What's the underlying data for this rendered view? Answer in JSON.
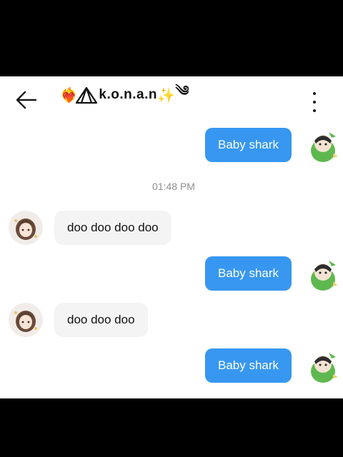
{
  "header": {
    "title": "k.o.n.a.n",
    "title_prefix_icon": "heart-on-fire-emoji",
    "title_suffix_icons": [
      "sparkles-emoji",
      "wind-swirl-emoji"
    ],
    "back_icon": "back-arrow-icon",
    "menu_icon": "more-vertical-icon"
  },
  "messages": [
    {
      "direction": "outgoing",
      "text": "Baby shark"
    },
    {
      "type": "timestamp",
      "text": "01:48 PM"
    },
    {
      "direction": "incoming",
      "text": "doo doo doo doo"
    },
    {
      "direction": "outgoing",
      "text": "Baby shark"
    },
    {
      "direction": "incoming",
      "text": "doo doo doo"
    },
    {
      "direction": "outgoing",
      "text": "Baby shark"
    }
  ],
  "colors": {
    "outgoing_bubble": "#3797f0",
    "incoming_bubble": "#f5f4f4",
    "timestamp_text": "#8e8e8e"
  }
}
